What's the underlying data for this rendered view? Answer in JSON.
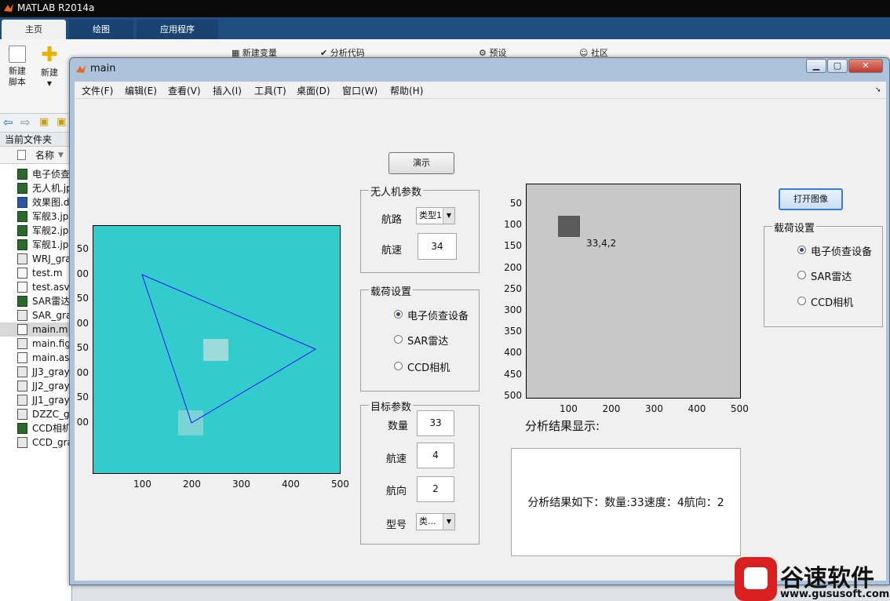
{
  "app": {
    "title": "MATLAB R2014a"
  },
  "tabs": [
    "主页",
    "绘图",
    "应用程序"
  ],
  "ribbon": {
    "new_script": "新建\n脚本",
    "new": "新建",
    "new_var": "新建变量",
    "analyze_code": "分析代码",
    "prefs": "预设",
    "community": "社区"
  },
  "filebrowser": {
    "current_folder": "当前文件夹",
    "name_col": "名称",
    "files": [
      {
        "name": "电子侦查",
        "kind": "img"
      },
      {
        "name": "无人机.jp",
        "kind": "img"
      },
      {
        "name": "效果图.d",
        "kind": "w"
      },
      {
        "name": "军舰3.jp",
        "kind": "img"
      },
      {
        "name": "军舰2.jp",
        "kind": "img"
      },
      {
        "name": "军舰1.jp",
        "kind": "img"
      },
      {
        "name": "WRJ_gra",
        "kind": "fig"
      },
      {
        "name": "test.m",
        "kind": "m"
      },
      {
        "name": "test.asv",
        "kind": "m"
      },
      {
        "name": "SAR雷达",
        "kind": "img"
      },
      {
        "name": "SAR_gra",
        "kind": "fig"
      },
      {
        "name": "main.m",
        "kind": "m",
        "selected": true
      },
      {
        "name": "main.fig",
        "kind": "fig"
      },
      {
        "name": "main.asv",
        "kind": "m"
      },
      {
        "name": "JJ3_gray",
        "kind": "fig"
      },
      {
        "name": "JJ2_gray",
        "kind": "fig"
      },
      {
        "name": "JJ1_gray",
        "kind": "fig"
      },
      {
        "name": "DZZC_gr",
        "kind": "fig"
      },
      {
        "name": "CCD相机",
        "kind": "img"
      },
      {
        "name": "CCD_gra",
        "kind": "fig"
      }
    ]
  },
  "figure": {
    "title": "main",
    "menu": [
      "文件(F)",
      "编辑(E)",
      "查看(V)",
      "插入(I)",
      "工具(T)",
      "桌面(D)",
      "窗口(W)",
      "帮助(H)"
    ],
    "demo_button": "演示",
    "open_image_button": "打开图像",
    "uav_panel": {
      "title": "无人机参数",
      "route_label": "航路",
      "route_value": "类型1",
      "speed_label": "航速",
      "speed_value": "34"
    },
    "payload_panel": {
      "title": "载荷设置",
      "options": [
        "电子侦查设备",
        "SAR雷达",
        "CCD相机"
      ],
      "selected": 0
    },
    "payload_panel_right": {
      "title": "载荷设置",
      "options": [
        "电子侦查设备",
        "SAR雷达",
        "CCD相机"
      ],
      "selected": 0
    },
    "target_panel": {
      "title": "目标参数",
      "count_label": "数量",
      "count_value": "33",
      "speed_label": "航速",
      "speed_value": "4",
      "heading_label": "航向",
      "heading_value": "2",
      "model_label": "型号",
      "model_value": "类..."
    },
    "result_label": "分析结果显示:",
    "result_text": "分析结果如下：数量:33速度：4航向：2",
    "left_axes": {
      "bg": "#33cccc",
      "xticks": [
        "100",
        "200",
        "300",
        "400",
        "500"
      ],
      "yticks": [
        "50",
        "00",
        "50",
        "00",
        "50",
        "00",
        "50",
        "00"
      ]
    },
    "right_axes": {
      "bg": "#c8c8c8",
      "xticks": [
        "100",
        "200",
        "300",
        "400",
        "500"
      ],
      "yticks": [
        "50",
        "100",
        "150",
        "200",
        "250",
        "300",
        "350",
        "400",
        "450",
        "500"
      ],
      "annotation": "33,4,2"
    }
  },
  "watermark": {
    "brand": "谷速软件",
    "url": "www.gususoft.com"
  }
}
